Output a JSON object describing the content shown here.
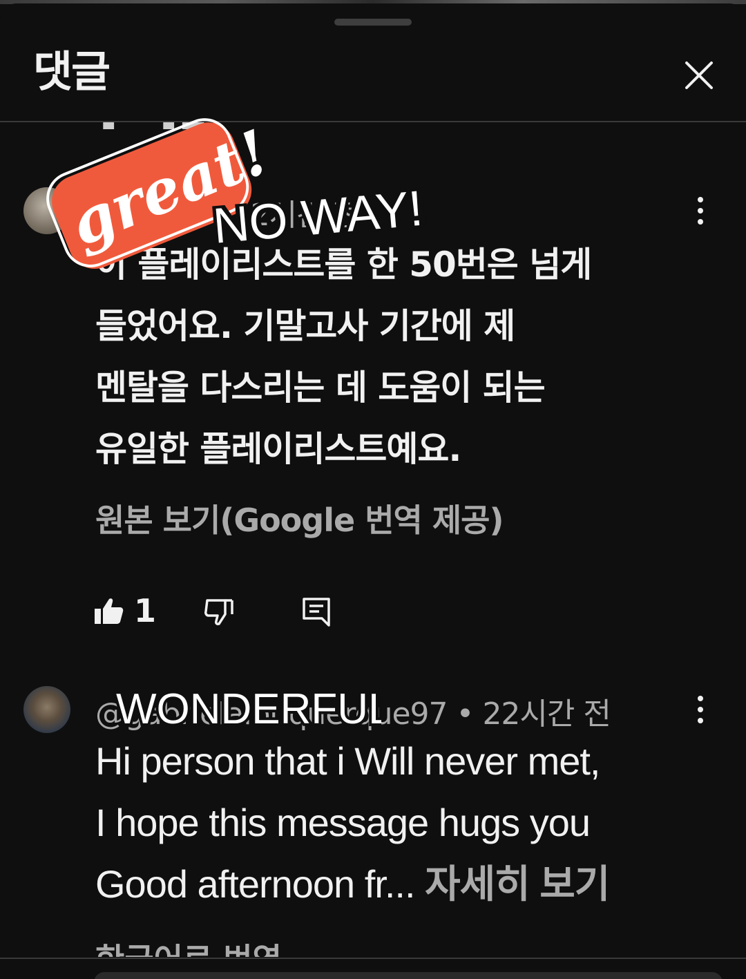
{
  "header": {
    "title": "댓글",
    "close_icon": "close-icon"
  },
  "comments": [
    {
      "author": "@...m8...",
      "separator": "•",
      "time": "12시간 전",
      "meta_text": "...m8... • 12시간 전",
      "lines": [
        "이 플레이리스트를 한 50번은 넘게",
        "들었어요. 기말고사 기간에 제",
        "멘탈을 다스리는 데 도움이 되는",
        "유일한 플레이리스트예요."
      ],
      "translation_link": "원본 보기(Google 번역 제공)",
      "likes": "1"
    },
    {
      "author": "@gabrielalbuquerque97",
      "separator": "•",
      "time": "22시간 전",
      "meta_text": "@gabrielalbuquerque97 • 22시간 전",
      "lines": [
        "Hi person that i Will never met,",
        "I hope this message hugs you",
        "Good afternoon fr..."
      ],
      "read_more": "자세히 보기",
      "translation_link": "한국어로 번역"
    }
  ],
  "stickers": {
    "great": "great!",
    "noway": "NO WAY!",
    "wonderful": "WONDERFUL"
  },
  "colors": {
    "background": "#0f0f0f",
    "text_primary": "#f1f1f1",
    "text_secondary": "#aaaaaa",
    "sticker_orange": "#f05a3c"
  }
}
